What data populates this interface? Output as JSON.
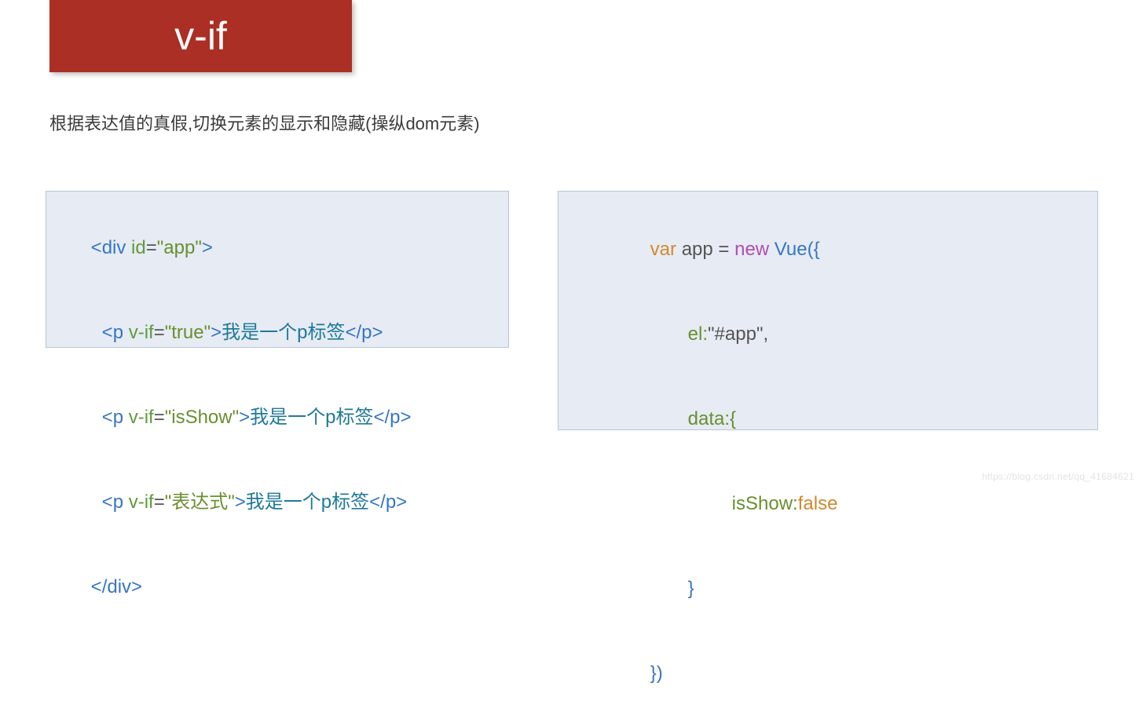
{
  "banner": {
    "title": "v-if"
  },
  "subtitle": "根据表达值的真假,切换元素的显示和隐藏(操纵dom元素)",
  "left": {
    "open_div_lt": "<div ",
    "open_div_id_attr": "id",
    "open_div_eq": "=",
    "open_div_id_val": "\"app\"",
    "open_div_gt": ">",
    "p_open_lt": "<p ",
    "vif_attr": "v-if",
    "eq": "=",
    "val_true": "\"true\"",
    "val_isShow": "\"isShow\"",
    "val_expr": "\"表达式\"",
    "p_open_gt": ">",
    "p_text": "我是一个p标签",
    "p_close": "</p>",
    "div_close": "</div>"
  },
  "right": {
    "kw_var": "var",
    "sp": " ",
    "app": "app ",
    "eq": "= ",
    "kw_new": "new",
    "vue_open": " Vue({",
    "el_key": "el:",
    "el_val": "\"#app\",",
    "data_key": "data:{",
    "isShow_key": "isShow:",
    "false_kw": "false",
    "brace_close": "}",
    "paren_close": "})"
  },
  "watermark": "https://blog.csdn.net/qq_41684621"
}
